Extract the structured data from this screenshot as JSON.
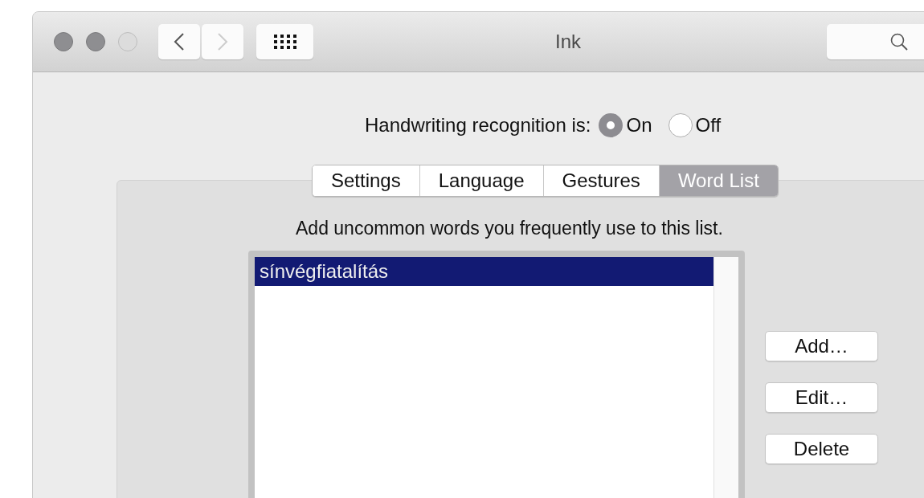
{
  "window": {
    "title": "Ink"
  },
  "recognition": {
    "label": "Handwriting recognition is:",
    "options": [
      {
        "label": "On",
        "selected": true
      },
      {
        "label": "Off",
        "selected": false
      }
    ]
  },
  "tabs": [
    {
      "label": "Settings",
      "selected": false
    },
    {
      "label": "Language",
      "selected": false
    },
    {
      "label": "Gestures",
      "selected": false
    },
    {
      "label": "Word List",
      "selected": true
    }
  ],
  "description": "Add uncommon words you frequently use to this list.",
  "word_list": [
    {
      "text": "sínvégfiatalítás",
      "selected": true
    }
  ],
  "buttons": [
    "Add…",
    "Edit…",
    "Delete"
  ]
}
